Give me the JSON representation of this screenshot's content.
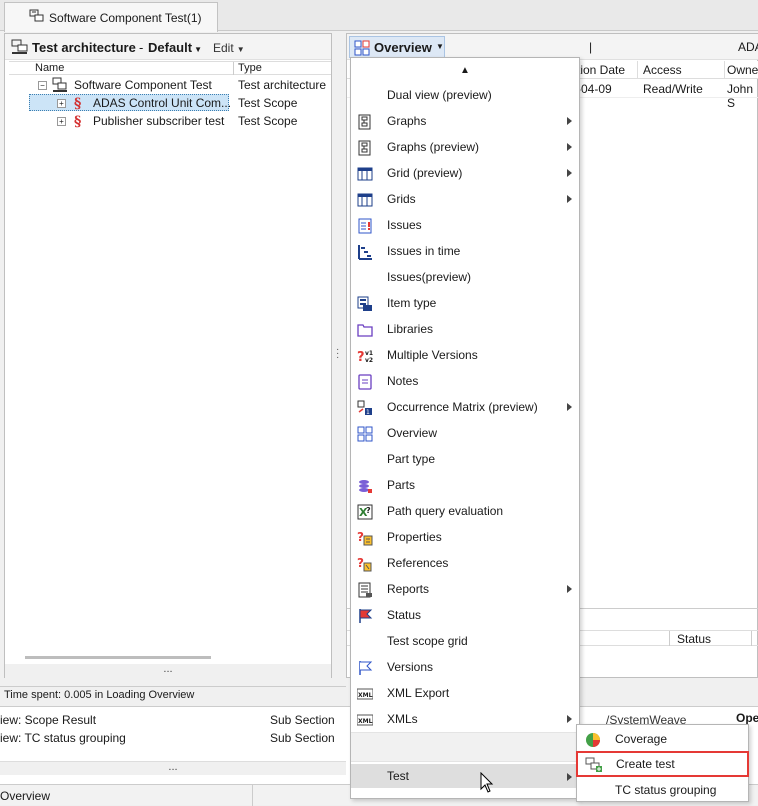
{
  "tab": {
    "title": "Software Component Test(1)"
  },
  "left": {
    "toolbar": {
      "title": "Test architecture",
      "view": "Default",
      "edit": "Edit"
    },
    "columns": [
      "Name",
      "Type"
    ],
    "rows": [
      {
        "name": "Software Component Test",
        "type": "Test architecture"
      },
      {
        "name": "ADAS Control Unit Com...",
        "type": "Test Scope"
      },
      {
        "name": "Publisher subscriber test",
        "type": "Test Scope"
      }
    ],
    "footer": "..."
  },
  "right": {
    "toolbar": {
      "title": "Overview",
      "separator": "|",
      "fragment": "ADA"
    },
    "columns": [
      "tion Date",
      "Access",
      "Owne"
    ],
    "row": {
      "date": "-04-09",
      "access": "Read/Write",
      "owner": "John S"
    },
    "status_header": "Status"
  },
  "status_bar": "Time spent: 0.005 in Loading Overview",
  "bottom": {
    "rows": [
      {
        "name": "iew: Scope Result",
        "type": "Sub Section",
        "path": "/SystemWeave",
        "extra": "Ope"
      },
      {
        "name": "iew: TC status grouping",
        "type": "Sub Section"
      }
    ],
    "footer": "...",
    "tab_label": "Overview"
  },
  "menu": {
    "scroll_up": "▲",
    "items": [
      {
        "label": "Dual view (preview)",
        "icon": "none",
        "submenu": false
      },
      {
        "label": "Graphs",
        "icon": "graph-icon",
        "submenu": true
      },
      {
        "label": "Graphs (preview)",
        "icon": "graph-icon",
        "submenu": true
      },
      {
        "label": "Grid (preview)",
        "icon": "grid-icon",
        "submenu": true
      },
      {
        "label": "Grids",
        "icon": "grid-icon",
        "submenu": true
      },
      {
        "label": "Issues",
        "icon": "issues-icon",
        "submenu": false
      },
      {
        "label": "Issues in time",
        "icon": "issues-in-time-icon",
        "submenu": false
      },
      {
        "label": "Issues(preview)",
        "icon": "none",
        "submenu": false
      },
      {
        "label": "Item type",
        "icon": "item-type-icon",
        "submenu": false
      },
      {
        "label": "Libraries",
        "icon": "folder-icon",
        "submenu": false
      },
      {
        "label": "Multiple Versions",
        "icon": "versions-compare-icon",
        "submenu": false
      },
      {
        "label": "Notes",
        "icon": "notes-icon",
        "submenu": false
      },
      {
        "label": "Occurrence Matrix (preview)",
        "icon": "matrix-icon",
        "submenu": true
      },
      {
        "label": "Overview",
        "icon": "overview-icon",
        "submenu": false
      },
      {
        "label": "Part type",
        "icon": "none",
        "submenu": false
      },
      {
        "label": "Parts",
        "icon": "parts-icon",
        "submenu": false
      },
      {
        "label": "Path query evaluation",
        "icon": "path-query-icon",
        "submenu": false
      },
      {
        "label": "Properties",
        "icon": "properties-icon",
        "submenu": false
      },
      {
        "label": "References",
        "icon": "references-icon",
        "submenu": false
      },
      {
        "label": "Reports",
        "icon": "reports-icon",
        "submenu": true
      },
      {
        "label": "Status",
        "icon": "flag-icon",
        "submenu": false
      },
      {
        "label": "Test scope grid",
        "icon": "none",
        "submenu": false
      },
      {
        "label": "Versions",
        "icon": "flag-outline-icon",
        "submenu": false
      },
      {
        "label": "XML Export",
        "icon": "xml-icon",
        "submenu": false
      },
      {
        "label": "XMLs",
        "icon": "xml-icon",
        "submenu": true
      }
    ],
    "test_item": "Test"
  },
  "submenu": {
    "items": [
      {
        "label": "Coverage",
        "icon": "pie-chart-icon"
      },
      {
        "label": "Create test",
        "icon": "create-test-icon"
      },
      {
        "label": "TC status grouping",
        "icon": "none"
      }
    ]
  },
  "colors": {
    "selection": "#cce4f7",
    "highlight_border": "#e53935",
    "accent": "#2f55c9"
  }
}
